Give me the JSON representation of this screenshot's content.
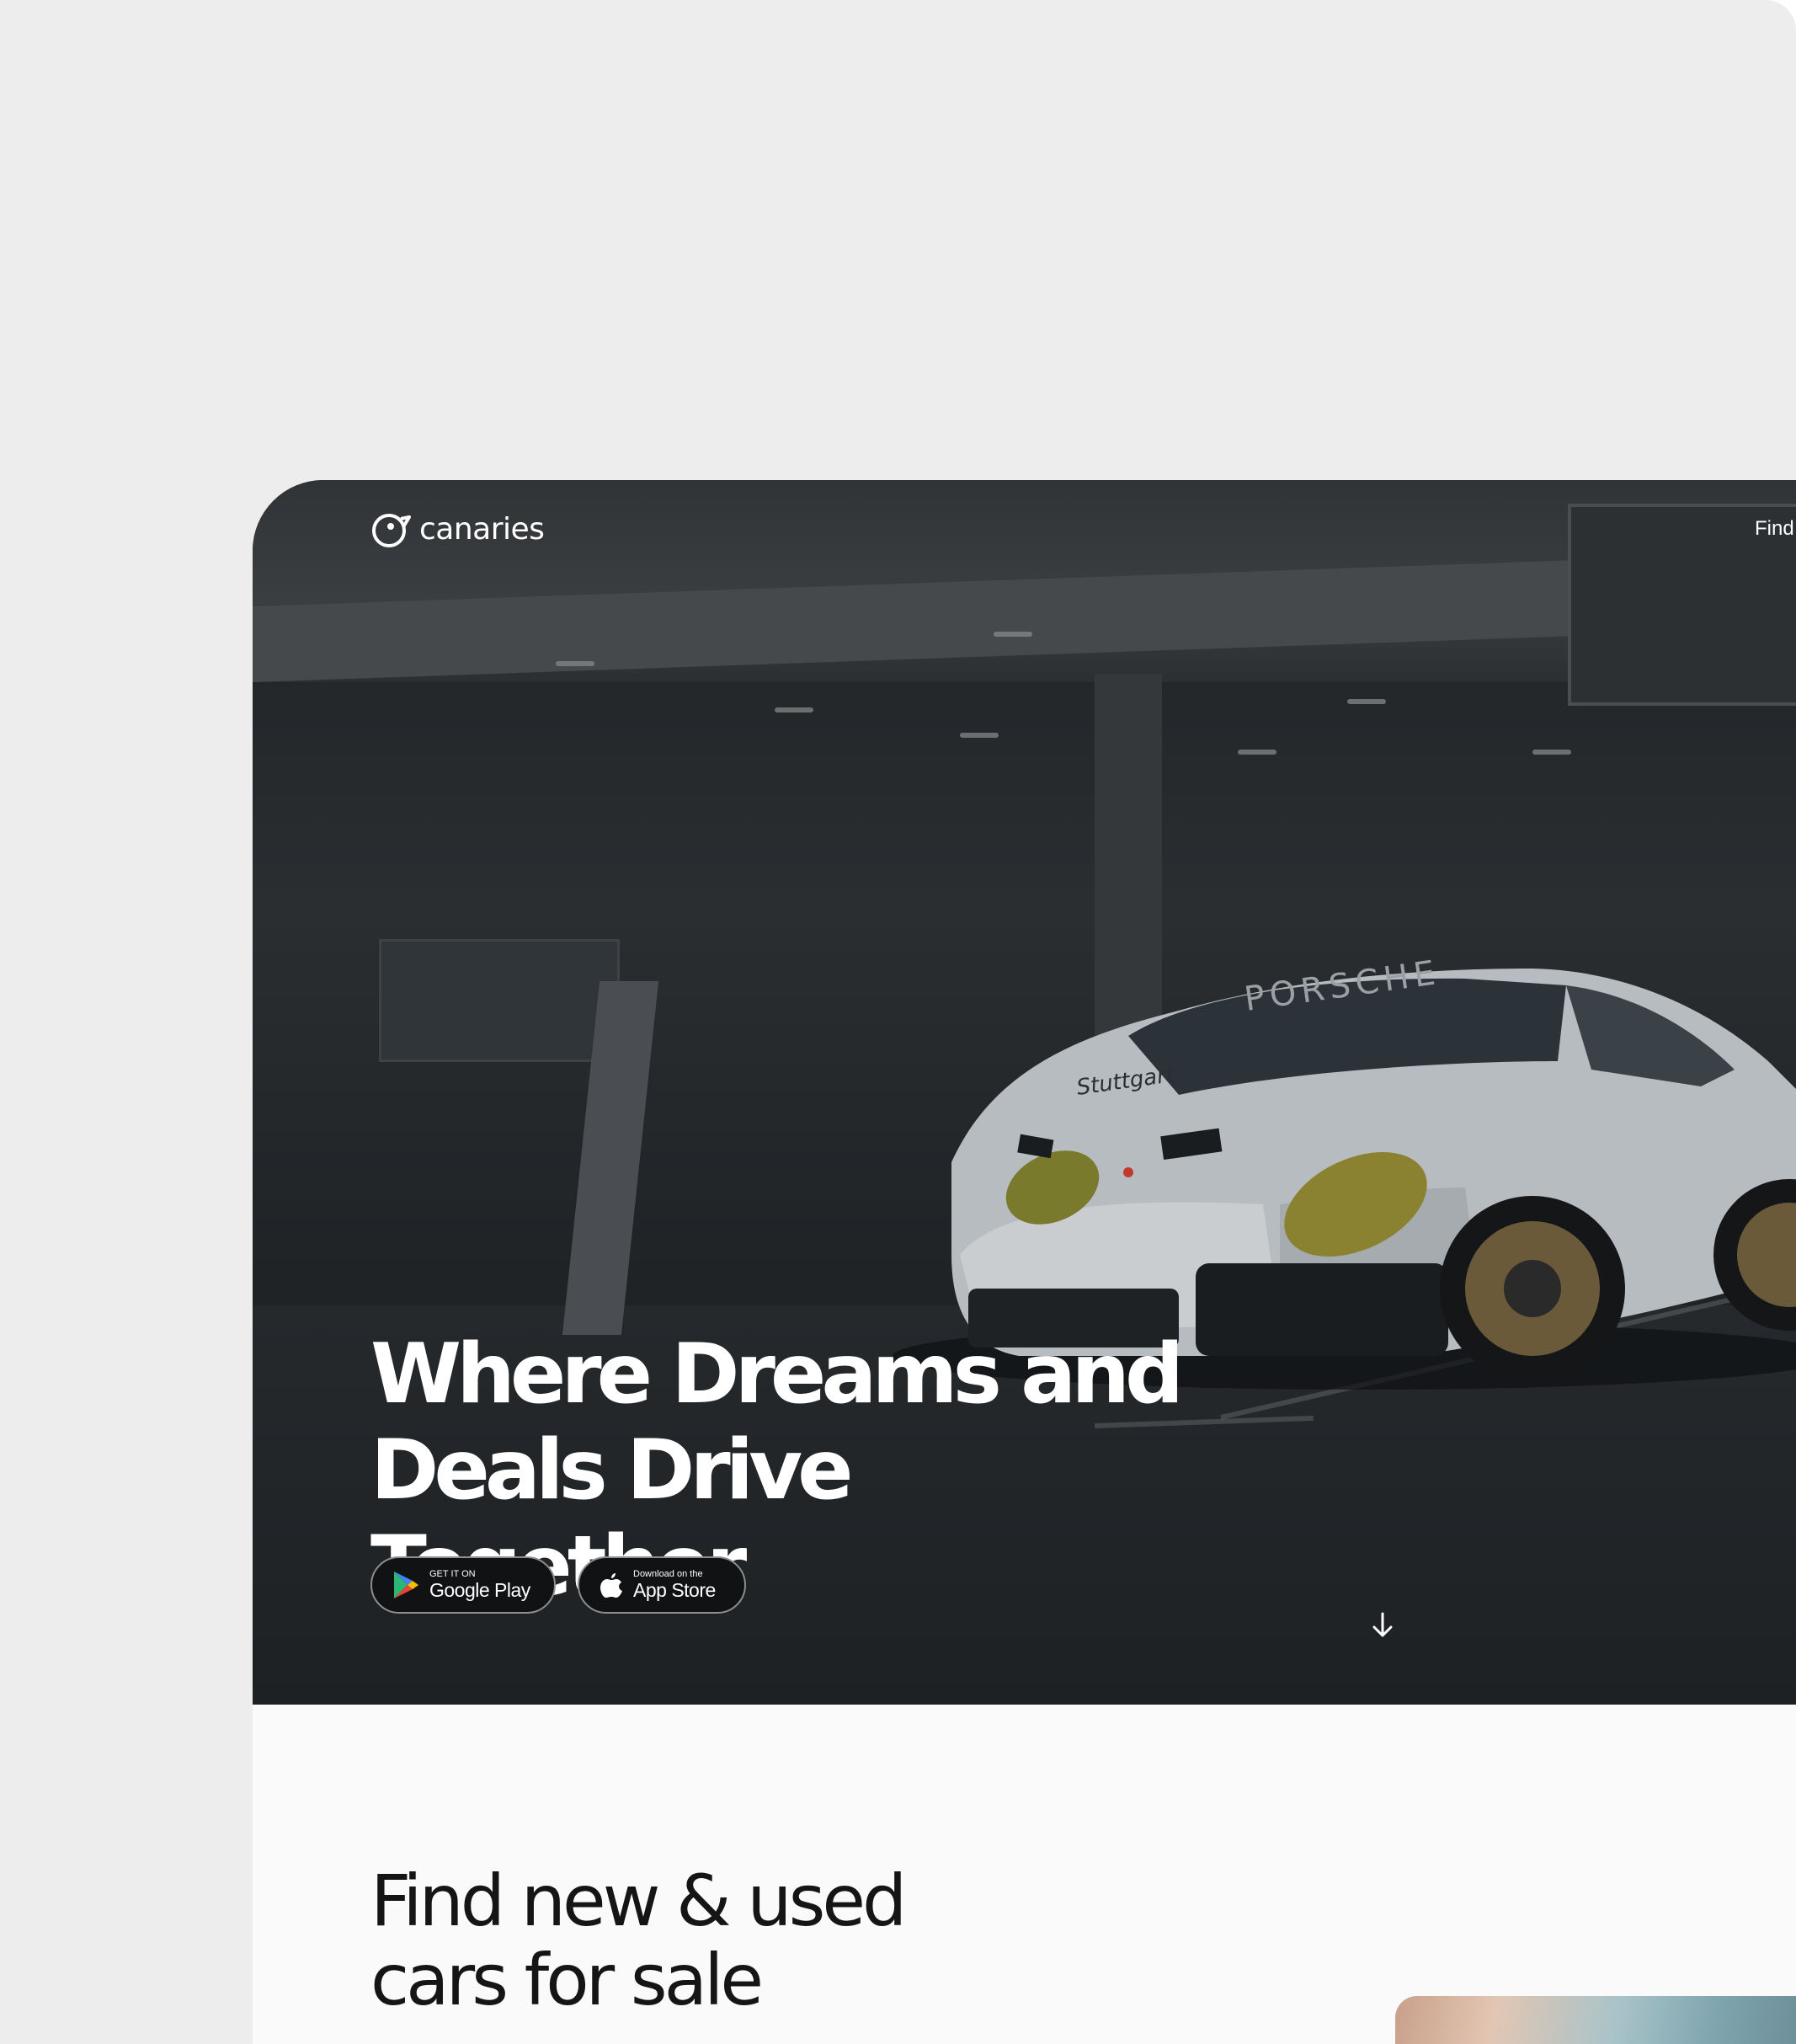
{
  "brand": {
    "name": "canaries"
  },
  "nav": {
    "link_label": "Find y"
  },
  "hero": {
    "headline": "Where Dreams and Deals Drive Together",
    "google_play": {
      "small": "GET IT ON",
      "big": "Google Play"
    },
    "app_store": {
      "small": "Download on the",
      "big": "App Store"
    },
    "car_plate": "Stuttgart",
    "car_brand_banner": "PORSCHE"
  },
  "section": {
    "title": "Find new & used cars for sale"
  },
  "colors": {
    "hero_bg": "#1d2124",
    "page_bg": "#fafafa",
    "outer_bg": "#ededed",
    "text_dark": "#151515"
  },
  "icons": [
    "canaries-logo-icon",
    "google-play-icon",
    "apple-icon",
    "arrow-down-icon"
  ]
}
